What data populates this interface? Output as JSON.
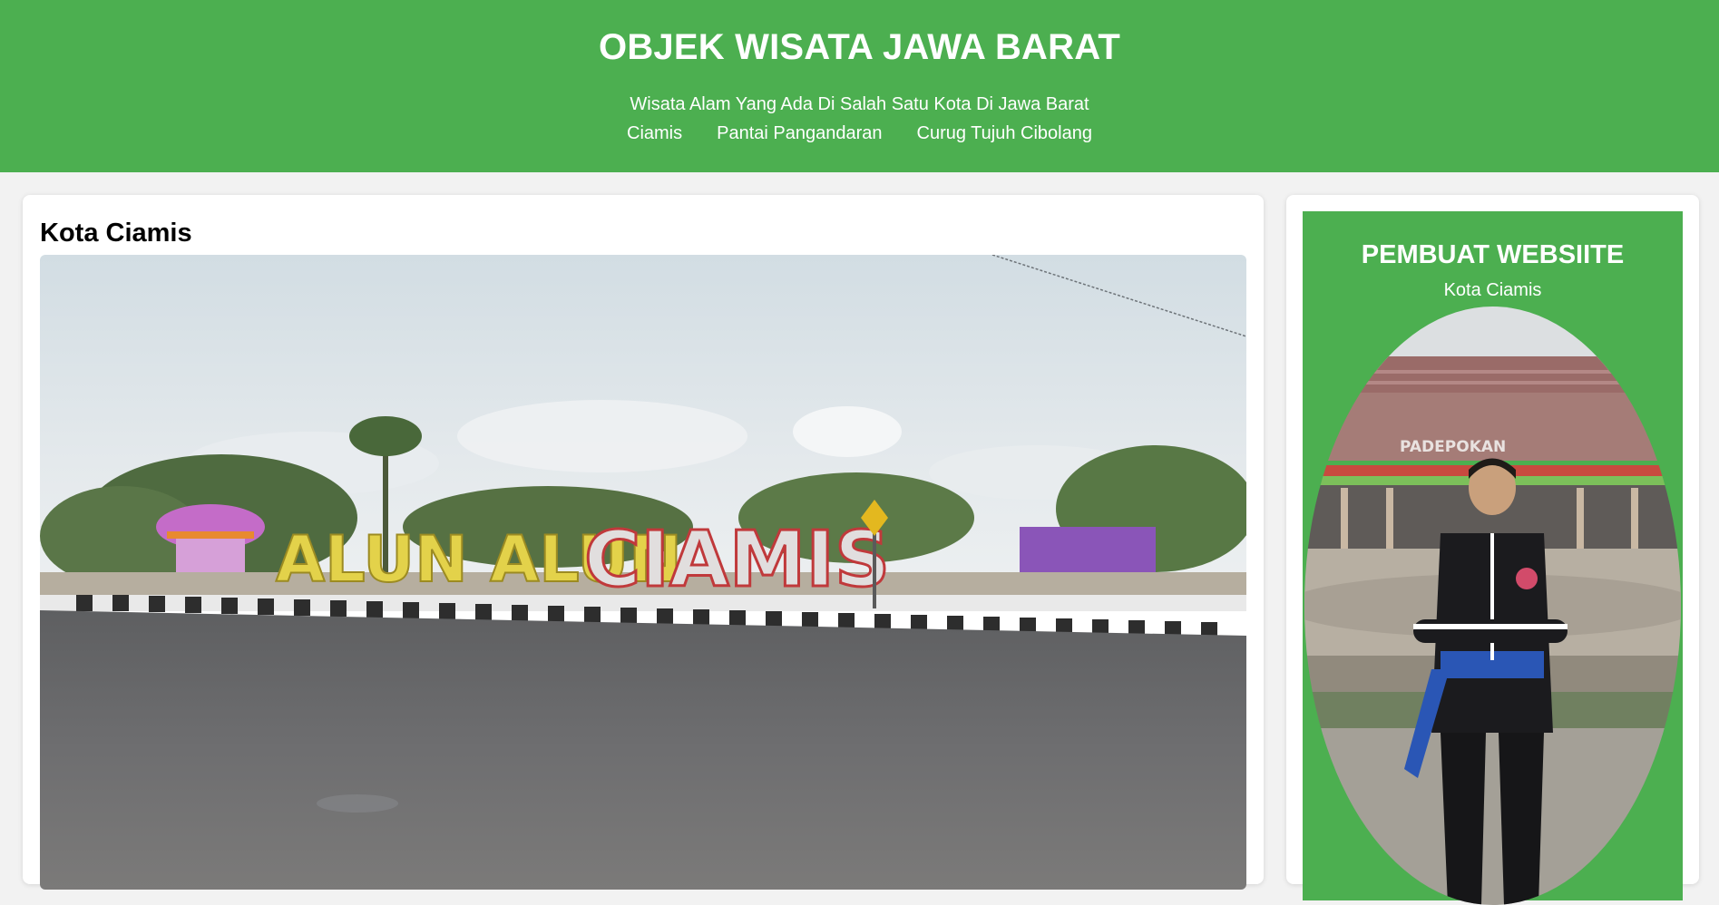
{
  "header": {
    "title": "OBJEK WISATA JAWA BARAT",
    "subtitle": "Wisata Alam Yang Ada Di Salah Satu Kota Di Jawa Barat",
    "nav": [
      {
        "label": "Ciamis"
      },
      {
        "label": "Pantai Pangandaran"
      },
      {
        "label": "Curug Tujuh Cibolang"
      }
    ]
  },
  "main": {
    "heading": "Kota Ciamis",
    "photo": {
      "sign_text": "ALUN ALUN CIAMIS"
    }
  },
  "sidebar": {
    "title": "PEMBUAT WEBSIITE",
    "subtitle": "Kota Ciamis",
    "photo": {
      "building_text": "PADEPOKAN"
    }
  },
  "colors": {
    "header_bg": "#4caf50",
    "page_bg": "#f2f2f2",
    "card_bg": "#ffffff",
    "text_light": "#ffffff",
    "text_dark": "#000000"
  }
}
